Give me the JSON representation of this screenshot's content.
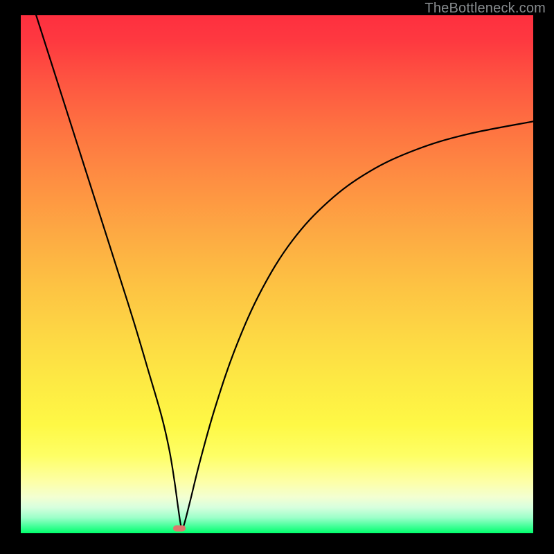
{
  "watermark": "TheBottleneck.com",
  "chart_data": {
    "type": "line",
    "title": "",
    "xlabel": "",
    "ylabel": "",
    "xlim": [
      0,
      100
    ],
    "ylim": [
      0,
      100
    ],
    "series": [
      {
        "name": "bottleneck-curve",
        "x": [
          3.0,
          8.0,
          13.0,
          18.0,
          22.0,
          25.0,
          27.5,
          29.0,
          30.0,
          30.7,
          31.3,
          31.8,
          33.0,
          35.0,
          38.0,
          42.0,
          47.0,
          53.0,
          60.0,
          68.0,
          77.0,
          87.0,
          100.0
        ],
        "values": [
          100.0,
          84.5,
          69.0,
          53.5,
          41.0,
          31.0,
          22.5,
          16.0,
          10.0,
          5.0,
          1.3,
          1.5,
          6.0,
          14.0,
          24.5,
          36.0,
          47.0,
          56.5,
          64.0,
          69.8,
          74.0,
          77.0,
          79.5
        ]
      }
    ],
    "marker": {
      "x": 31.0,
      "y": 0.9
    },
    "gradient_colors": {
      "top": "#fe2f3f",
      "mid": "#fde544",
      "bottom": "#00ff6c"
    }
  }
}
